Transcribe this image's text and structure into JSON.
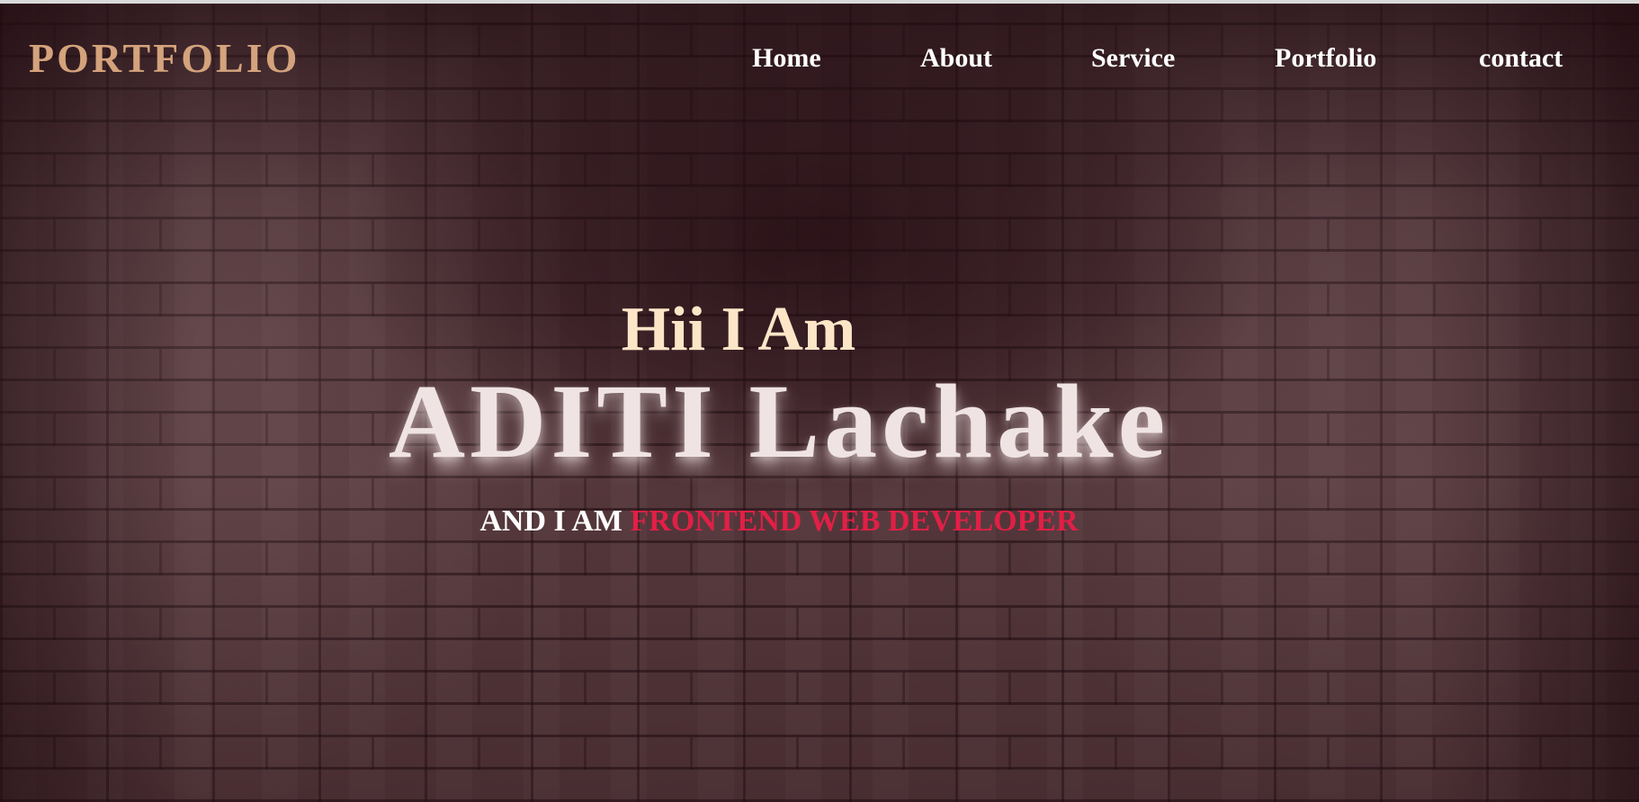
{
  "header": {
    "logo": "PORTFOLIO",
    "nav": [
      {
        "label": "Home"
      },
      {
        "label": "About"
      },
      {
        "label": "Service"
      },
      {
        "label": "Portfolio"
      },
      {
        "label": "contact"
      }
    ]
  },
  "hero": {
    "greeting": "Hii I Am",
    "name": "ADITI Lachake",
    "tagline_prefix": "AND I AM",
    "tagline_role": "FRONTEND WEB DEVELOPER"
  },
  "colors": {
    "logo": "#d4a37c",
    "greeting": "#fde6c8",
    "name": "#efe3e4",
    "role_accent": "#e21f46",
    "nav_text": "#ffffff"
  }
}
